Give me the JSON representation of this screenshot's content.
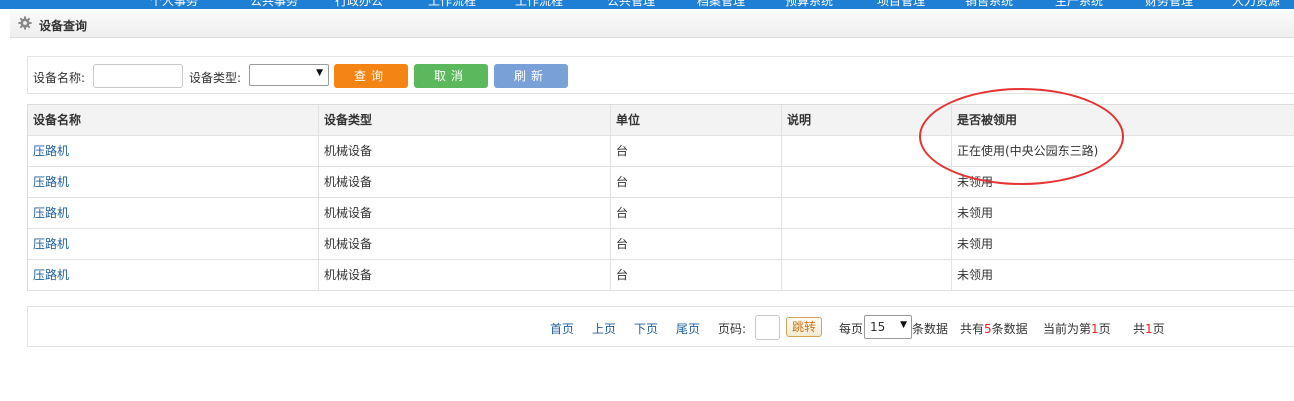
{
  "topnav": {
    "items": [
      "个人事务",
      "公共事务",
      "行政办公",
      "工作流程",
      "工作流程",
      "公共管理",
      "档案管理",
      "预算系统",
      "项目管理",
      "销售系统",
      "生产系统",
      "财务管理",
      "人力资源"
    ]
  },
  "panel": {
    "title": "设备查询",
    "icon": "gear-icon"
  },
  "search": {
    "name_label": "设备名称:",
    "name_value": "",
    "type_label": "设备类型:",
    "type_selected": "",
    "query_label": "查询",
    "cancel_label": "取消",
    "refresh_label": "刷新"
  },
  "table": {
    "headers": [
      "设备名称",
      "设备类型",
      "单位",
      "说明",
      "是否被领用"
    ],
    "rows": [
      [
        "压路机",
        "机械设备",
        "台",
        "",
        "正在使用(中央公园东三路)"
      ],
      [
        "压路机",
        "机械设备",
        "台",
        "",
        "未领用"
      ],
      [
        "压路机",
        "机械设备",
        "台",
        "",
        "未领用"
      ],
      [
        "压路机",
        "机械设备",
        "台",
        "",
        "未领用"
      ],
      [
        "压路机",
        "机械设备",
        "台",
        "",
        "未领用"
      ]
    ]
  },
  "pager": {
    "first": "首页",
    "prev": "上页",
    "next": "下页",
    "last": "尾页",
    "page_label": "页码:",
    "jump": "跳转",
    "per_page_prefix": "每页",
    "per_page_value": "15",
    "per_page_suffix": "条数据",
    "total_prefix": "共有",
    "total_count": "5",
    "total_suffix": "条数据",
    "current_prefix": "当前为第",
    "current_page": "1",
    "current_suffix": "页",
    "pages_prefix": "共",
    "pages_count": "1",
    "pages_suffix": "页"
  },
  "colors": {
    "nav": "#1f7fd4",
    "query": "#f48414",
    "cancel": "#5cb85c",
    "refresh": "#7aa0d8",
    "annotation": "#e53333",
    "link": "#1f5f9a"
  }
}
